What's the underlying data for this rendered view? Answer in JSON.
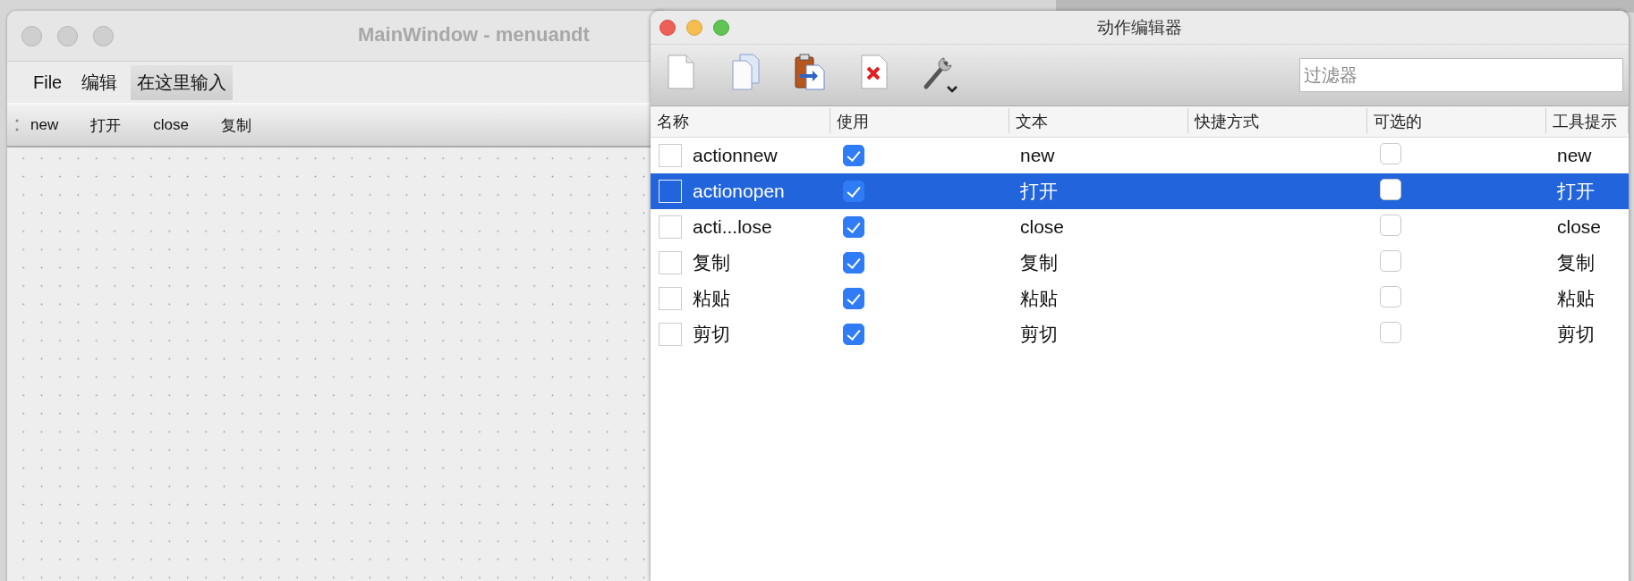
{
  "main_window": {
    "title": "MainWindow - menuandt",
    "menu": [
      {
        "label": "File",
        "kind": "menu"
      },
      {
        "label": "编辑",
        "kind": "menu"
      },
      {
        "label": "在这里输入",
        "kind": "type-here"
      }
    ],
    "toolbar": [
      "new",
      "打开",
      "close",
      "复制"
    ]
  },
  "action_editor": {
    "title": "动作编辑器",
    "filter": {
      "placeholder": "过滤器"
    },
    "columns": [
      "名称",
      "使用",
      "文本",
      "快捷方式",
      "可选的",
      "工具提示"
    ],
    "rows": [
      {
        "name": "actionnew",
        "used": true,
        "text": "new",
        "checkable": false,
        "tooltip": "new",
        "selected": false
      },
      {
        "name": "actionopen",
        "used": true,
        "text": "打开",
        "checkable": false,
        "tooltip": "打开",
        "selected": true
      },
      {
        "name": "acti...lose",
        "used": true,
        "text": "close",
        "checkable": false,
        "tooltip": "close",
        "selected": false
      },
      {
        "name": "复制",
        "used": true,
        "text": "复制",
        "checkable": false,
        "tooltip": "复制",
        "selected": false
      },
      {
        "name": "粘贴",
        "used": true,
        "text": "粘贴",
        "checkable": false,
        "tooltip": "粘贴",
        "selected": false
      },
      {
        "name": "剪切",
        "used": true,
        "text": "剪切",
        "checkable": false,
        "tooltip": "剪切",
        "selected": false
      }
    ]
  }
}
